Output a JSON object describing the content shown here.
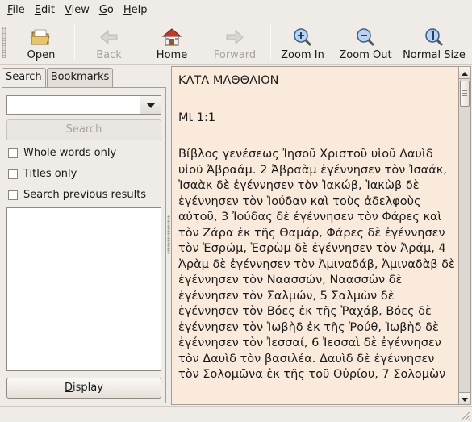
{
  "menubar": {
    "items": [
      {
        "label": "File",
        "mnemonic": "F",
        "rest": "ile"
      },
      {
        "label": "Edit",
        "mnemonic": "E",
        "rest": "dit"
      },
      {
        "label": "View",
        "mnemonic": "V",
        "rest": "iew"
      },
      {
        "label": "Go",
        "mnemonic": "G",
        "rest": "o"
      },
      {
        "label": "Help",
        "mnemonic": "H",
        "rest": "elp"
      }
    ]
  },
  "toolbar": {
    "open": "Open",
    "back": "Back",
    "home": "Home",
    "forward": "Forward",
    "zoom_in": "Zoom In",
    "zoom_out": "Zoom Out",
    "normal_size": "Normal Size"
  },
  "sidebar": {
    "tabs": {
      "search": {
        "pre": "",
        "mnemonic": "S",
        "post": "earch"
      },
      "bookmarks": {
        "pre": "Book",
        "mnemonic": "m",
        "post": "arks"
      }
    },
    "search_value": "",
    "search_button": "Search",
    "options": {
      "whole_words": {
        "pre": "",
        "mnemonic": "W",
        "post": "hole words only"
      },
      "titles_only": {
        "pre": "",
        "mnemonic": "T",
        "post": "itles only"
      },
      "search_previous": {
        "pre": "Search previous results",
        "mnemonic": "",
        "post": ""
      }
    },
    "display_button": {
      "pre": "",
      "mnemonic": "D",
      "post": "isplay"
    }
  },
  "content": {
    "book_title": "ΚΑΤΑ ΜΑΘΘΑΙΟΝ",
    "reference": "Mt 1:1",
    "text": "Βίβλος γενέσεως Ἰησοῦ Χριστοῦ υἱοῦ Δαυὶδ υἱοῦ Ἀβραάμ. 2 Ἀβραὰμ ἐγέννησεν τὸν Ἰσαάκ, Ἰσαὰκ δὲ ἐγέννησεν τὸν Ἰακώβ, Ἰακὼβ δὲ ἐγέννησεν τὸν Ἰούδαν καὶ τοὺς ἀδελφοὺς αὐτοῦ, 3 Ἰούδας δὲ ἐγέννησεν τὸν Φάρες καὶ τὸν Ζάρα ἐκ τῆς Θαμάρ, Φάρες δὲ ἐγέννησεν τὸν Ἑσρώμ, Ἑσρὼμ δὲ ἐγέννησεν τὸν Ἀράμ, 4 Ἀρὰμ δὲ ἐγέννησεν τὸν Ἀμιναδάβ, Ἀμιναδὰβ δὲ ἐγέννησεν τὸν Ναασσών, Ναασσὼν δὲ ἐγέννησεν τὸν Σαλμών, 5 Σαλμὼν δὲ ἐγέννησεν τὸν Βόες ἐκ τῆς Ῥαχάβ, Βόες δὲ ἐγέννησεν τὸν Ἰωβὴδ ἐκ τῆς Ῥούθ, Ἰωβὴδ δὲ ἐγέννησεν τὸν Ἰεσσαί, 6 Ἰεσσαὶ δὲ ἐγέννησεν τὸν Δαυὶδ τὸν βασιλέα. Δαυὶδ δὲ ἐγέννησεν τὸν Σολομῶνα ἐκ τῆς τοῦ Οὐρίου, 7 Σολομὼν"
  },
  "colors": {
    "window_bg": "#efebe7",
    "content_bg": "#faeadb",
    "icon_blue": "#4f7fc4",
    "home_red": "#c0392b"
  }
}
